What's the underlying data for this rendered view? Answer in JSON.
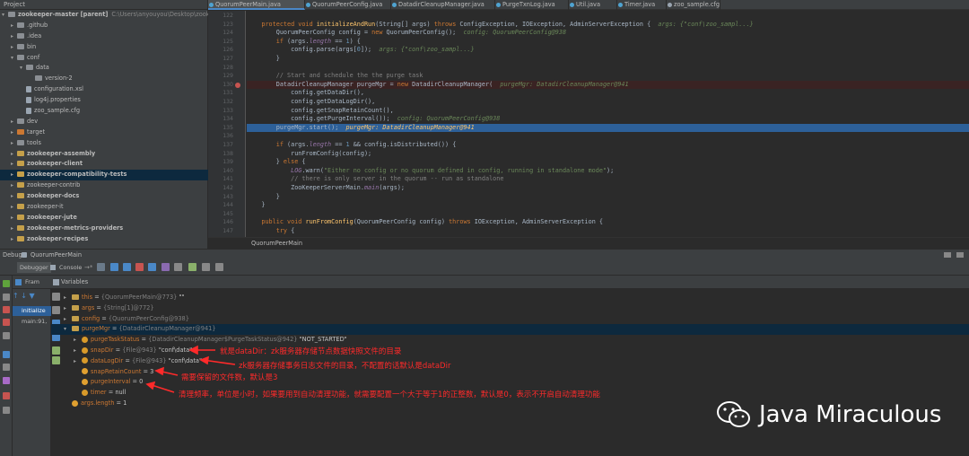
{
  "project": {
    "header": "Project",
    "items": [
      {
        "label": "zookeeper-master [parent]",
        "path": "C:\\Users\\anyouyou\\Desktop\\zook",
        "depth": 0,
        "arrow": "▾",
        "icon": "folder",
        "bold": true
      },
      {
        "label": ".github",
        "depth": 1,
        "arrow": "▸",
        "icon": "folder"
      },
      {
        "label": ".idea",
        "depth": 1,
        "arrow": "▸",
        "icon": "folder"
      },
      {
        "label": "bin",
        "depth": 1,
        "arrow": "▸",
        "icon": "folder"
      },
      {
        "label": "conf",
        "depth": 1,
        "arrow": "▾",
        "icon": "folder"
      },
      {
        "label": "data",
        "depth": 2,
        "arrow": "▾",
        "icon": "folder"
      },
      {
        "label": "version-2",
        "depth": 3,
        "arrow": "",
        "icon": "folder"
      },
      {
        "label": "configuration.xsl",
        "depth": 2,
        "arrow": "",
        "icon": "file"
      },
      {
        "label": "log4j.properties",
        "depth": 2,
        "arrow": "",
        "icon": "file"
      },
      {
        "label": "zoo_sample.cfg",
        "depth": 2,
        "arrow": "",
        "icon": "file"
      },
      {
        "label": "dev",
        "depth": 1,
        "arrow": "▸",
        "icon": "folder"
      },
      {
        "label": "target",
        "depth": 1,
        "arrow": "▸",
        "icon": "folder-orange"
      },
      {
        "label": "tools",
        "depth": 1,
        "arrow": "▸",
        "icon": "folder"
      },
      {
        "label": "zookeeper-assembly",
        "depth": 1,
        "arrow": "▸",
        "icon": "module",
        "bold": true
      },
      {
        "label": "zookeeper-client",
        "depth": 1,
        "arrow": "▸",
        "icon": "module",
        "bold": true
      },
      {
        "label": "zookeeper-compatibility-tests",
        "depth": 1,
        "arrow": "▸",
        "icon": "module",
        "bold": true,
        "highlight": true
      },
      {
        "label": "zookeeper-contrib",
        "depth": 1,
        "arrow": "▸",
        "icon": "module"
      },
      {
        "label": "zookeeper-docs",
        "depth": 1,
        "arrow": "▸",
        "icon": "module",
        "bold": true
      },
      {
        "label": "zookeeper-it",
        "depth": 1,
        "arrow": "▸",
        "icon": "module"
      },
      {
        "label": "zookeeper-jute",
        "depth": 1,
        "arrow": "▸",
        "icon": "module",
        "bold": true
      },
      {
        "label": "zookeeper-metrics-providers",
        "depth": 1,
        "arrow": "▸",
        "icon": "module",
        "bold": true
      },
      {
        "label": "zookeeper-recipes",
        "depth": 1,
        "arrow": "▸",
        "icon": "module",
        "bold": true
      }
    ]
  },
  "editor": {
    "tabs": [
      "QuorumPeerMain.java",
      "QuorumPeerConfig.java",
      "DatadirCleanupManager.java",
      "PurgeTxnLog.java",
      "Util.java",
      "Timer.java",
      "zoo_sample.cfg"
    ],
    "active_tab": 0,
    "breadcrumb": "QuorumPeerMain",
    "lines": [
      {
        "n": "122",
        "html": ""
      },
      {
        "n": "123",
        "html": "    <span class='kw'>protected void</span> <span class='fn'>initializeAndRun</span>(String[] args) <span class='kw'>throws</span> ConfigException, IOException, AdminServerException {  <span class='hint'>args: {\"conf\\zoo_sampl...}</span>"
      },
      {
        "n": "124",
        "html": "        QuorumPeerConfig config = <span class='kw'>new</span> QuorumPeerConfig();  <span class='hint'>config: QuorumPeerConfig@938</span>"
      },
      {
        "n": "125",
        "html": "        <span class='kw'>if</span> (args.<span class='it'>length</span> == <span class='num'>1</span>) {"
      },
      {
        "n": "126",
        "html": "            config.parse(args[<span class='num'>0</span>]);  <span class='hint'>args: {\"conf\\zoo_sampl...}</span>"
      },
      {
        "n": "127",
        "html": "        }"
      },
      {
        "n": "128",
        "html": ""
      },
      {
        "n": "129",
        "html": "        <span class='cm'>// Start and schedule the the purge task</span>"
      },
      {
        "n": "130",
        "html": "        DatadirCleanupManager purgeMgr = <span class='kw'>new</span> DatadirCleanupManager(  <span class='hint'>purgeMgr: DatadirCleanupManager@941</span>",
        "bp": true
      },
      {
        "n": "131",
        "html": "            config.getDataDir(),"
      },
      {
        "n": "132",
        "html": "            config.getDataLogDir(),"
      },
      {
        "n": "133",
        "html": "            config.getSnapRetainCount(),"
      },
      {
        "n": "134",
        "html": "            config.getPurgeInterval());  <span class='hint'>config: QuorumPeerConfig@938</span>"
      },
      {
        "n": "135",
        "html": "        purgeMgr.start();  <span class='hintw'>purgeMgr: DatadirCleanupManager@941</span>",
        "cur": true
      },
      {
        "n": "136",
        "html": ""
      },
      {
        "n": "137",
        "html": "        <span class='kw'>if</span> (args.<span class='it'>length</span> == <span class='num'>1</span> &amp;&amp; config.isDistributed()) {"
      },
      {
        "n": "138",
        "html": "            runFromConfig(config);"
      },
      {
        "n": "139",
        "html": "        } <span class='kw'>else</span> {"
      },
      {
        "n": "140",
        "html": "            <span class='it'>LOG</span>.warn(<span class='str'>\"Either no config or no quorum defined in config, running in standalone mode\"</span>);"
      },
      {
        "n": "141",
        "html": "            <span class='cm'>// there is only server in the quorum -- run as standalone</span>"
      },
      {
        "n": "142",
        "html": "            ZooKeeperServerMain.<span class='it'>main</span>(args);"
      },
      {
        "n": "143",
        "html": "        }"
      },
      {
        "n": "144",
        "html": "    }"
      },
      {
        "n": "145",
        "html": ""
      },
      {
        "n": "146",
        "html": "    <span class='kw'>public void</span> <span class='fn'>runFromConfig</span>(QuorumPeerConfig config) <span class='kw'>throws</span> IOException, AdminServerException {"
      },
      {
        "n": "147",
        "html": "        <span class='kw'>try</span> {"
      }
    ]
  },
  "debug": {
    "title": "Debug",
    "config_name": "QuorumPeerMain",
    "tabs": [
      "Debugger",
      "Console"
    ],
    "frames_label": "Fram",
    "variables_label": "Variables",
    "frames": [
      "initialize",
      "main:91,"
    ],
    "variables": [
      {
        "indent": 0,
        "arrow": "▸",
        "icon": "obj",
        "name": "this",
        "eq": " = ",
        "type": "{QuorumPeerMain@773}",
        "val": " \"\""
      },
      {
        "indent": 0,
        "arrow": "▸",
        "icon": "obj",
        "name": "args",
        "eq": " = ",
        "type": "{String[1]@772}",
        "val": ""
      },
      {
        "indent": 0,
        "arrow": "▸",
        "icon": "obj",
        "name": "config",
        "eq": " = ",
        "type": "{QuorumPeerConfig@938}",
        "val": ""
      },
      {
        "indent": 0,
        "arrow": "▾",
        "icon": "obj",
        "name": "purgeMgr",
        "eq": " = ",
        "type": "{DatadirCleanupManager@941}",
        "val": "",
        "selected": true
      },
      {
        "indent": 1,
        "arrow": "▸",
        "icon": "field",
        "name": "purgeTaskStatus",
        "eq": " = ",
        "type": "{DatadirCleanupManager$PurgeTaskStatus@942}",
        "val": " \"NOT_STARTED\""
      },
      {
        "indent": 1,
        "arrow": "▸",
        "icon": "field",
        "name": "snapDir",
        "eq": " = ",
        "type": "{File@943}",
        "val": " \"conf\\data\""
      },
      {
        "indent": 1,
        "arrow": "▸",
        "icon": "field",
        "name": "dataLogDir",
        "eq": " = ",
        "type": "{File@943}",
        "val": " \"conf\\data\""
      },
      {
        "indent": 1,
        "arrow": "",
        "icon": "prim",
        "name": "snapRetainCount",
        "eq": " = ",
        "type": "",
        "val": "3"
      },
      {
        "indent": 1,
        "arrow": "",
        "icon": "prim",
        "name": "purgeInterval",
        "eq": " = ",
        "type": "",
        "val": "0"
      },
      {
        "indent": 1,
        "arrow": "",
        "icon": "field",
        "name": "timer",
        "eq": " = ",
        "type": "",
        "val": "null"
      },
      {
        "indent": 0,
        "arrow": "",
        "icon": "prim",
        "name": "args.length",
        "eq": " = ",
        "type": "",
        "val": "1"
      }
    ]
  },
  "annotations": [
    "就是dataDir：zk服务器存储节点数据快照文件的目录",
    "zk服务器存储事务日志文件的目录，不配置的话默认是dataDir",
    "需要保留的文件数，默认是3",
    "清理频率，单位是小时，如果要用到自动清理功能，就需要配置一个大于等于1的正整数，默认是0，表示不开启自动清理功能"
  ],
  "watermark": "Java Miraculous",
  "colors": {
    "annotation": "#ff2a2a",
    "selection": "#0d293e",
    "current_line": "#2d6099",
    "breakpoint": "#c75450"
  }
}
